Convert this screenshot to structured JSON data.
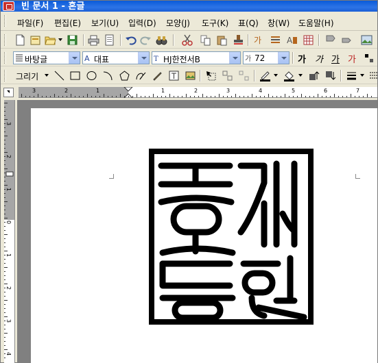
{
  "window": {
    "title": "빈 문서 1 - 혼글"
  },
  "menu": {
    "items": [
      {
        "label": "파일(F)"
      },
      {
        "label": "편집(E)"
      },
      {
        "label": "보기(U)"
      },
      {
        "label": "입력(D)"
      },
      {
        "label": "모양(J)"
      },
      {
        "label": "도구(K)"
      },
      {
        "label": "표(Q)"
      },
      {
        "label": "창(W)"
      },
      {
        "label": "도움말(H)"
      }
    ]
  },
  "format_toolbar": {
    "style": "바탕글",
    "font_lang": "대표",
    "font": "HJ한전서B",
    "font_size": "72",
    "char_buttons": [
      "가",
      "가",
      "가",
      "가"
    ]
  },
  "draw_toolbar": {
    "label": "그리기"
  },
  "ruler": {
    "h_numbers": [
      "3",
      "2",
      "1",
      "1",
      "2",
      "3",
      "4",
      "5",
      "6",
      "7"
    ],
    "v_numbers": [
      "3",
      "2",
      "1",
      "0",
      "1",
      "2",
      "3",
      "4"
    ]
  },
  "document": {
    "content": "seal-stamp-image"
  },
  "colors": {
    "title_bar": "#2d74e6",
    "chrome": "#ece9d8",
    "workspace": "#808080",
    "ruler_margin": "#a6a6a6"
  }
}
